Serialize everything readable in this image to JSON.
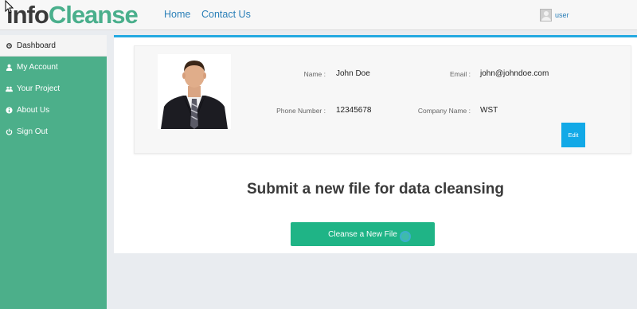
{
  "header": {
    "logo_part1": "info",
    "logo_part2": "Cleanse",
    "nav": {
      "home": "Home",
      "contact": "Contact Us"
    },
    "user_label": "user"
  },
  "sidebar": {
    "items": [
      {
        "label": "Dashboard",
        "icon": "gear-icon"
      },
      {
        "label": "My Account",
        "icon": "user-icon"
      },
      {
        "label": "Your Project",
        "icon": "users-icon"
      },
      {
        "label": "About Us",
        "icon": "info-icon"
      },
      {
        "label": "Sign Out",
        "icon": "power-icon"
      }
    ]
  },
  "profile": {
    "name_label": "Name :",
    "name": "John Doe",
    "email_label": "Email :",
    "email": "john@johndoe.com",
    "phone_label": "Phone Number :",
    "phone": "12345678",
    "company_label": "Company Name :",
    "company": "WST",
    "edit_label": "Edit"
  },
  "main": {
    "submit_title": "Submit a new file for data cleansing",
    "cleanse_button": "Cleanse a New File"
  },
  "colors": {
    "accent_green": "#4caf8a",
    "button_green": "#1fb486",
    "accent_blue": "#23a9e1",
    "link_blue": "#2a7fb8"
  }
}
